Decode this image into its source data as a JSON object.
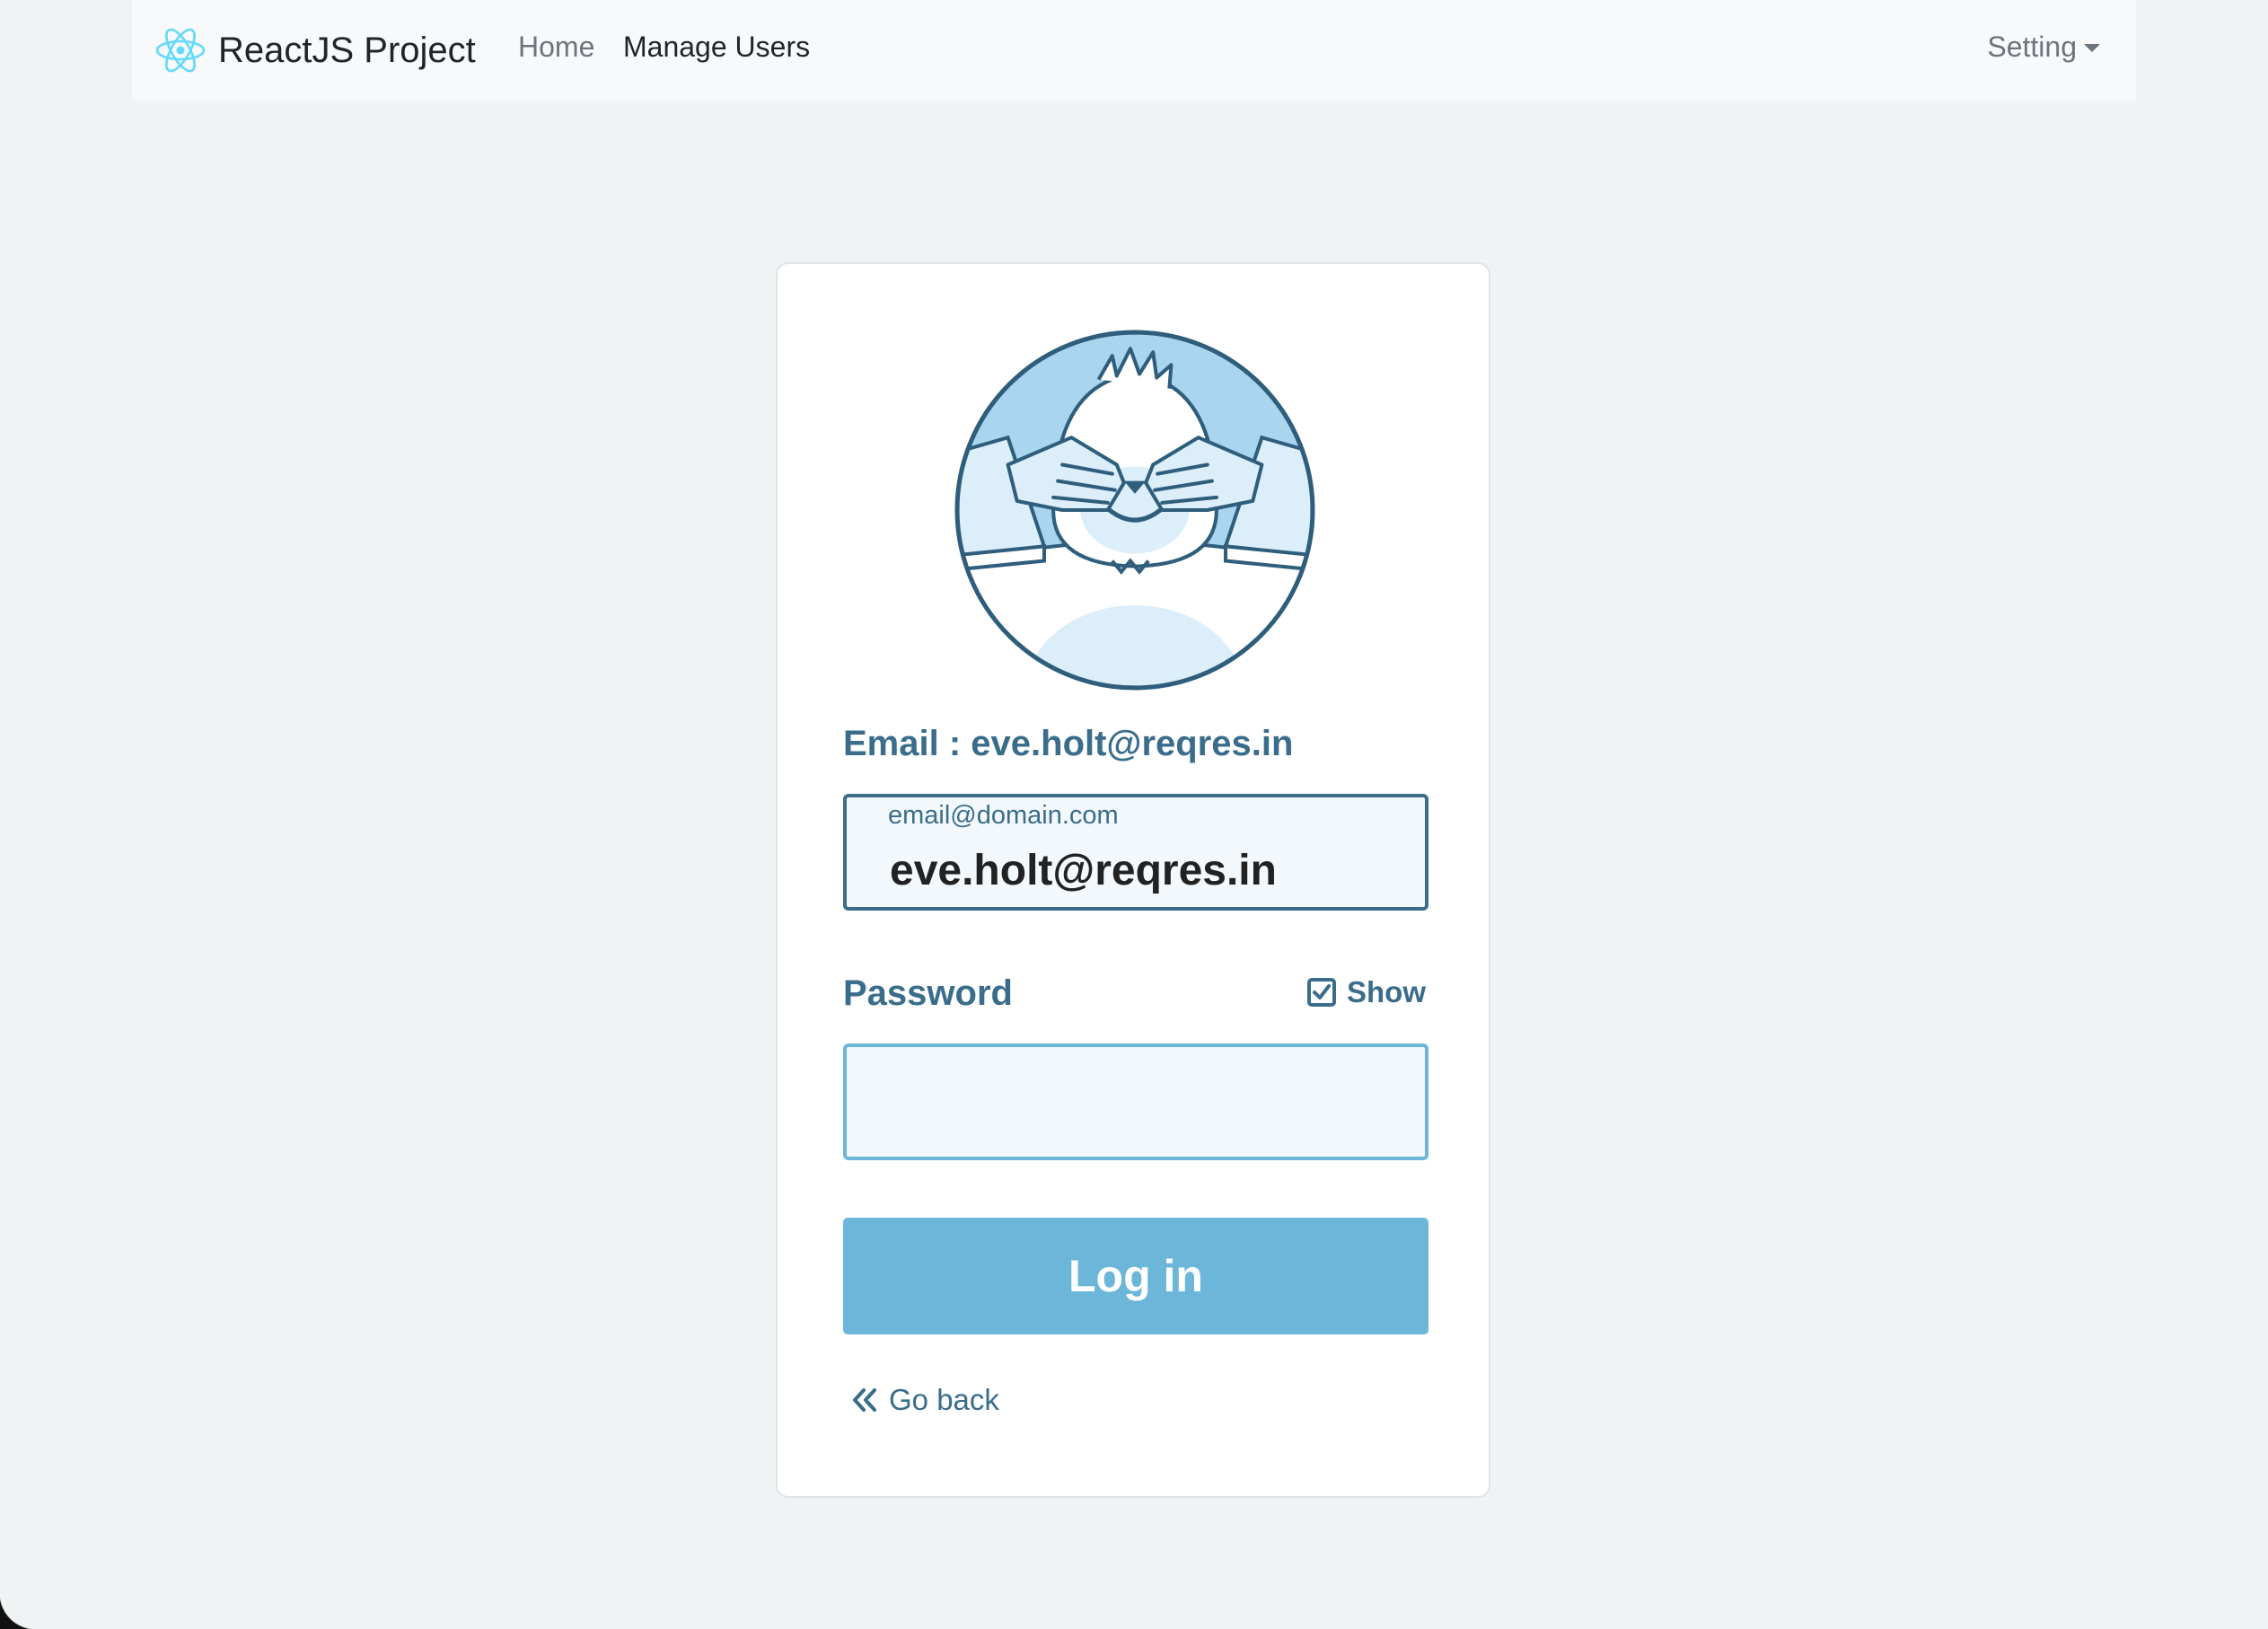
{
  "navbar": {
    "brand": "ReactJS Project",
    "links": {
      "home": "Home",
      "manage_users": "Manage Users"
    },
    "setting": "Setting"
  },
  "login": {
    "email_label": "Email :",
    "email_label_value": "eve.holt@reqres.in",
    "email_placeholder": "email@domain.com",
    "email_value": "eve.holt@reqres.in",
    "password_label": "Password",
    "show_label": "Show",
    "show_checked": true,
    "password_value": "",
    "submit_label": "Log in",
    "go_back_label": "Go back"
  },
  "colors": {
    "primary": "#3a6d8c",
    "accent": "#6cb7d9",
    "background": "#eff3f4",
    "react_logo": "#61dafb"
  },
  "icons": [
    "react-logo-icon",
    "chevron-down-icon",
    "yeti-avatar",
    "checkbox-checked-icon",
    "double-chevron-left-icon"
  ]
}
